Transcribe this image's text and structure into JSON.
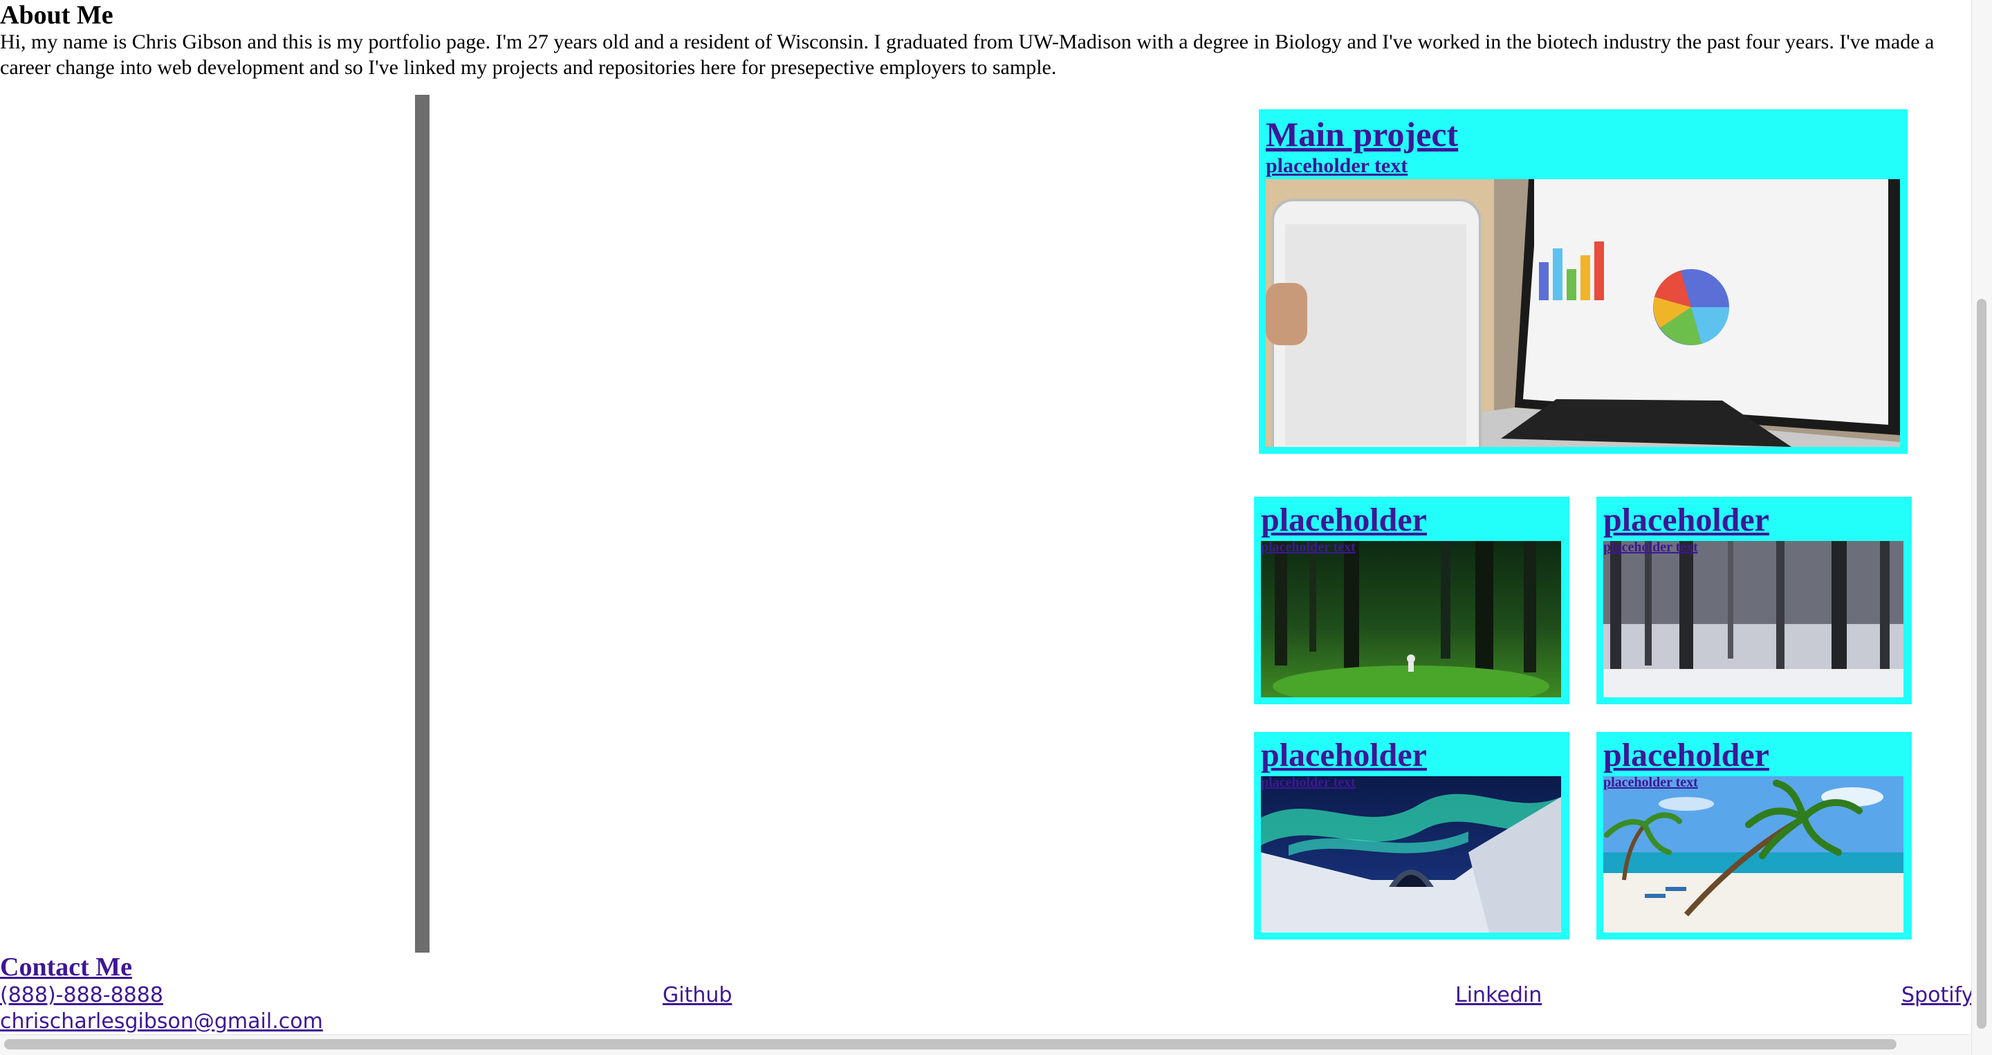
{
  "about": {
    "title": "About Me",
    "text": "Hi, my name is Chris Gibson and this is my portfolio page. I'm 27 years old and a resident of Wisconsin. I graduated from UW-Madison with a degree in Biology and I've worked in the biotech industry the past four years. I've made a career change into web development and so I've linked my projects and repositories here for presepective employers to sample."
  },
  "main_project": {
    "title": "Main project",
    "subtitle": "placeholder text",
    "image_icon": "laptop-tablet-photo"
  },
  "projects": [
    {
      "title": "placeholder",
      "subtitle": "placeholder text",
      "image_icon": "green-forest-photo"
    },
    {
      "title": "placeholder",
      "subtitle": "placeholder text",
      "image_icon": "snowy-forest-photo"
    },
    {
      "title": "placeholder",
      "subtitle": "placeholder text",
      "image_icon": "aurora-snow-tunnel-photo"
    },
    {
      "title": "placeholder",
      "subtitle": "placeholder text",
      "image_icon": "tropical-beach-photo"
    }
  ],
  "contact": {
    "title": "Contact Me",
    "phone": "(888)-888-8888",
    "email": "chrischarlesgibson@gmail.com",
    "github": "Github",
    "linkedin": "Linkedin",
    "spotify": "Spotify"
  },
  "colors": {
    "card_background": "#22fefa",
    "link": "#3e1796",
    "divider": "#6d6d6d"
  }
}
